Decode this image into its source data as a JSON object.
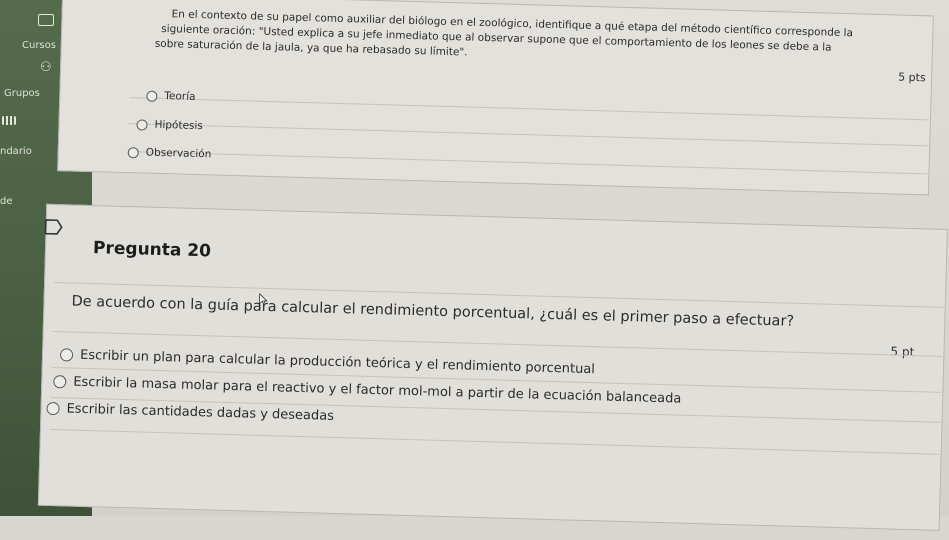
{
  "sidebar": {
    "items": [
      {
        "label": "Cursos",
        "icon": "courses-icon"
      },
      {
        "label": "Grupos",
        "icon": "groups-icon"
      },
      {
        "label": "ndario",
        "icon": "calendar-icon"
      },
      {
        "label": "de",
        "icon": ""
      }
    ]
  },
  "question19": {
    "text_line1": "En el contexto de su papel como auxiliar del biólogo en el zoológico, identifique a qué etapa del método científico corresponde la",
    "text_line2": "siguiente oración: \"Usted explica a su jefe inmediato que al observar supone que  el comportamiento de los leones se debe a la",
    "text_line3": "sobre saturación de la jaula, ya que ha rebasado su límite\".",
    "points": "5 pts",
    "options": [
      "Teoría",
      "Hipótesis",
      "Observación"
    ]
  },
  "question20": {
    "title": "Pregunta 20",
    "text": "De acuerdo con la guía para calcular el rendimiento porcentual, ¿cuál es el primer paso a efectuar?",
    "points": "5 pt",
    "options": [
      "Escribir un plan para calcular la producción teórica y el rendimiento porcentual",
      "Escribir la masa molar para el reactivo y el factor mol-mol a partir de la ecuación balanceada",
      "Escribir las cantidades dadas y deseadas"
    ]
  }
}
